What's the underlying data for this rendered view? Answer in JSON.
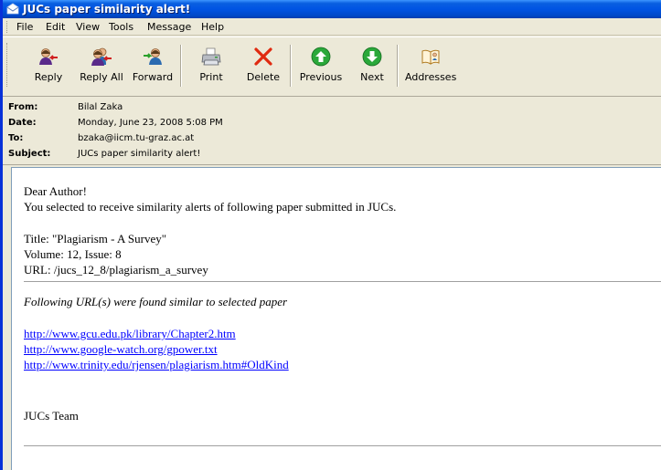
{
  "window": {
    "title": "JUCs paper similarity alert!"
  },
  "menu": [
    "File",
    "Edit",
    "View",
    "Tools",
    "Message",
    "Help"
  ],
  "toolbar": {
    "reply": "Reply",
    "reply_all": "Reply All",
    "forward": "Forward",
    "print": "Print",
    "delete": "Delete",
    "previous": "Previous",
    "next": "Next",
    "addresses": "Addresses"
  },
  "header": {
    "from_label": "From:",
    "from": "Bilal Zaka",
    "date_label": "Date:",
    "date": "Monday, June 23, 2008 5:08 PM",
    "to_label": "To:",
    "to": "bzaka@iicm.tu-graz.ac.at",
    "subject_label": "Subject:",
    "subject": "JUCs paper similarity alert!"
  },
  "message": {
    "greeting": "Dear Author!",
    "intro": "You selected to receive similarity alerts of following paper submitted in JUCs.",
    "title_line": "Title: \"Plagiarism - A Survey\"",
    "volume_line": "Volume: 12, Issue: 8",
    "url_line": "URL: /jucs_12_8/plagiarism_a_survey",
    "similar_heading": "Following URL(s) were found similar to selected paper",
    "links": [
      "http://www.gcu.edu.pk/library/Chapter2.htm",
      "http://www.google-watch.org/gpower.txt",
      "http://www.trinity.edu/rjensen/plagiarism.htm#OldKind"
    ],
    "signature": "JUCs Team"
  }
}
